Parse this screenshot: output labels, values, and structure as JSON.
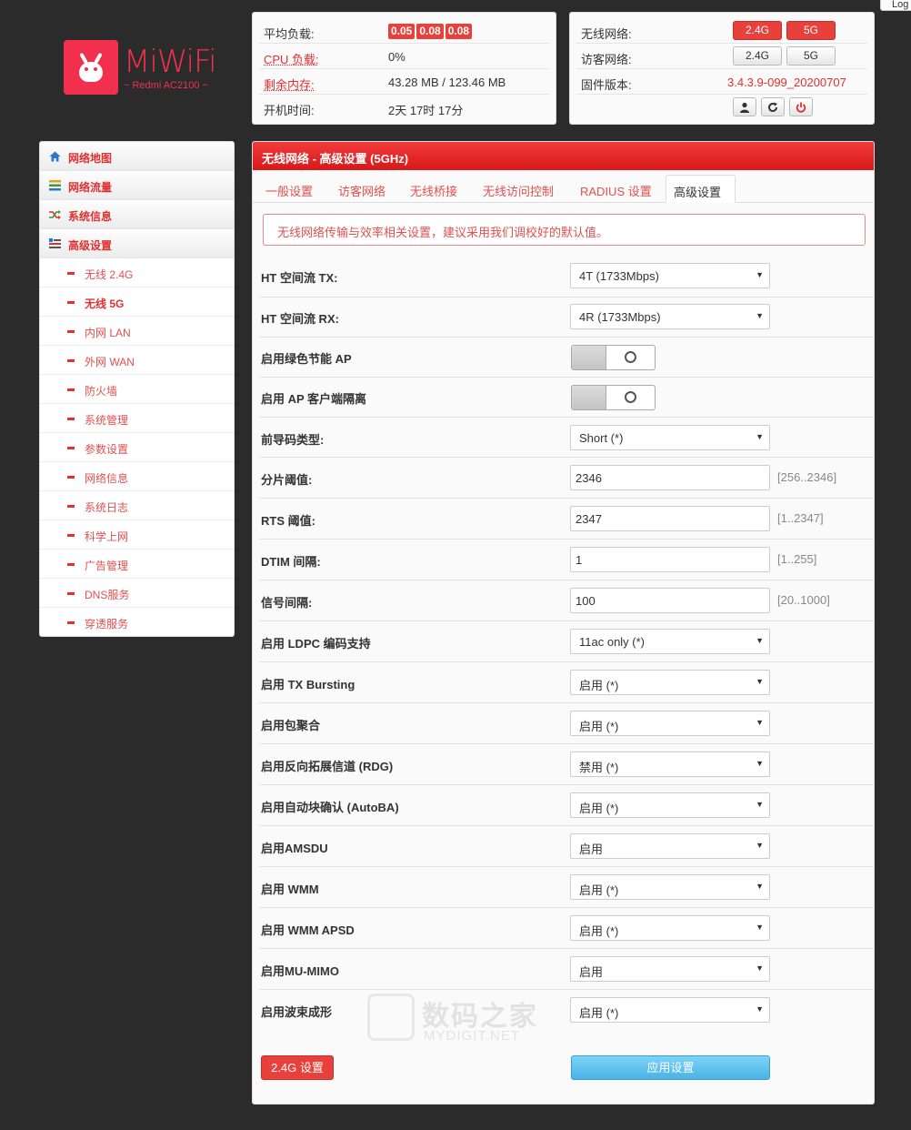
{
  "topbar": {
    "logout_label": "Log"
  },
  "brand": {
    "name": "MiWiFi",
    "model": "~ Redmi AC2100 ~"
  },
  "status": {
    "load_label": "平均负载:",
    "load_values": [
      "0.05",
      "0.08",
      "0.08"
    ],
    "cpu_label": "CPU 负载:",
    "cpu_value": "0%",
    "mem_label": "剩余内存:",
    "mem_value": "43.28 MB / 123.46 MB",
    "uptime_label": "开机时间:",
    "uptime_value": "2天 17时 17分"
  },
  "wifi": {
    "wireless_label": "无线网络:",
    "guest_label": "访客网络:",
    "firmware_label": "固件版本:",
    "firmware_value": "3.4.3.9-099_20200707",
    "band_24": "2.4G",
    "band_5": "5G",
    "accent": "#e8413c"
  },
  "sidebar": {
    "items": [
      {
        "label": "网络地图",
        "icon": "home-icon"
      },
      {
        "label": "网络流量",
        "icon": "bars-icon"
      },
      {
        "label": "系统信息",
        "icon": "shuffle-icon"
      },
      {
        "label": "高级设置",
        "icon": "settings-list-icon"
      }
    ],
    "subitems": [
      "无线 2.4G",
      "无线 5G",
      "内网 LAN",
      "外网 WAN",
      "防火墙",
      "系统管理",
      "参数设置",
      "网络信息",
      "系统日志",
      "科学上网",
      "广告管理",
      "DNS服务",
      "穿透服务"
    ]
  },
  "main": {
    "title": "无线网络 - 高级设置 (5GHz)",
    "tabs": [
      "一般设置",
      "访客网络",
      "无线桥接",
      "无线访问控制",
      "RADIUS 设置",
      "高级设置"
    ],
    "alert": "无线网络传输与效率相关设置，建议采用我们调校好的默认值。",
    "fields": [
      {
        "label": "HT 空间流 TX:",
        "value": "4T (1733Mbps)"
      },
      {
        "label": "HT 空间流 RX:",
        "value": "4R (1733Mbps)"
      },
      {
        "label": "启用绿色节能 AP"
      },
      {
        "label": "启用 AP 客户端隔离"
      },
      {
        "label": "前导码类型:",
        "value": "Short (*)"
      },
      {
        "label": "分片阈值:",
        "value": "2346",
        "hint": "[256..2346]"
      },
      {
        "label": "RTS 阈值:",
        "value": "2347",
        "hint": "[1..2347]"
      },
      {
        "label": "DTIM 间隔:",
        "value": "1",
        "hint": "[1..255]"
      },
      {
        "label": "信号间隔:",
        "value": "100",
        "hint": "[20..1000]"
      },
      {
        "label": "启用 LDPC 编码支持",
        "value": "11ac only (*)"
      },
      {
        "label": "启用 TX Bursting",
        "value": "启用 (*)"
      },
      {
        "label": "启用包聚合",
        "value": "启用 (*)"
      },
      {
        "label": "启用反向拓展信道 (RDG)",
        "value": "禁用 (*)"
      },
      {
        "label": "启用自动块确认 (AutoBA)",
        "value": "启用 (*)"
      },
      {
        "label": "启用AMSDU",
        "value": "启用"
      },
      {
        "label": "启用 WMM",
        "value": "启用 (*)"
      },
      {
        "label": "启用 WMM APSD",
        "value": "启用 (*)"
      },
      {
        "label": "启用MU-MIMO",
        "value": "启用"
      },
      {
        "label": "启用波束成形",
        "value": "启用 (*)"
      }
    ],
    "btn_24": "2.4G 设置",
    "btn_apply": "应用设置"
  },
  "watermark": {
    "title": "数码之家",
    "subtitle": "MYDIGIT.NET"
  }
}
